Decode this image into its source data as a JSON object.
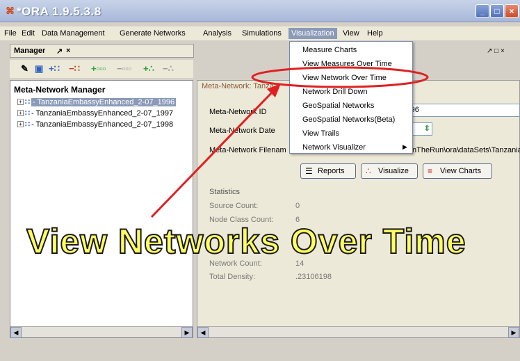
{
  "window": {
    "title": "*ORA 1.9.5.3.8"
  },
  "menu": [
    "File",
    "Edit",
    "Data Management",
    "Generate Networks",
    "Analysis",
    "Simulations",
    "Visualization",
    "View",
    "Help"
  ],
  "visualization_menu": [
    "Measure Charts",
    "View Measures Over Time",
    "View Network Over Time",
    "Network Drill Down",
    "GeoSpatial Networks",
    "GeoSpatial Networks(Beta)",
    "View Trails",
    "Network Visualizer"
  ],
  "manager": {
    "tab_label": "Manager",
    "header": "Meta-Network Manager"
  },
  "tree": [
    "TanzaniaEmbassyEnhanced_2-07_1996",
    "TanzaniaEmbassyEnhanced_2-07_1997",
    "TanzaniaEmbassyEnhanced_2-07_1998"
  ],
  "tree_prefix": "- ",
  "details": {
    "header": "Meta-Network: Tanza",
    "id_label": "Meta-Network ID",
    "id_value": "07_1996",
    "date_label": "Meta-Network Date",
    "date_value": "7",
    "filename_label": "Meta-Network Filenam",
    "filename_value": "nTheRun\\ora\\dataSets\\Tanzania",
    "buttons": {
      "reports": "Reports",
      "visualize": "Visualize",
      "view_charts": "View Charts"
    }
  },
  "statistics": {
    "title": "Statistics",
    "rows": [
      {
        "label": "Source Count:",
        "value": "0"
      },
      {
        "label": "Node Class Count:",
        "value": "6"
      },
      {
        "label": "Network Count:",
        "value": "14"
      },
      {
        "label": "Total Density:",
        "value": ".23106198"
      }
    ]
  },
  "overlay_caption": "View Networks Over Time",
  "colors": {
    "highlight_ring": "#e02020",
    "caption": "#fffe60",
    "menu_selected": "#8a9ab8"
  }
}
